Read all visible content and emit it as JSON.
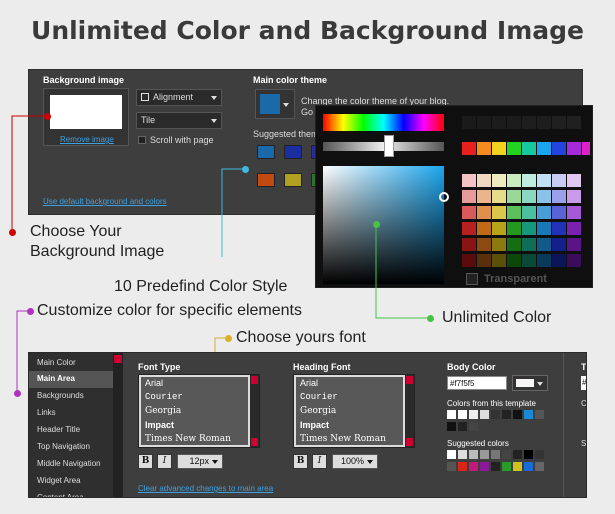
{
  "title": "Unlimited Color and Background Image",
  "background": {
    "label": "Background image",
    "remove_link": "Remove image",
    "alignment": "Alignment",
    "tile": "Tile",
    "scroll_with_page": "Scroll with page",
    "use_default_link": "Use default background and colors"
  },
  "main_theme": {
    "label": "Main color theme",
    "desc": "Change the color theme of your blog.",
    "desc2": "Go",
    "suggested": "Suggested theme",
    "selected_color": "#1a6aaa",
    "swatches": [
      "#1a6aaa",
      "#1a2ea0",
      "#2a2a9a",
      "#c04a10",
      "#b0a020",
      "#2f6f2f"
    ]
  },
  "picker": {
    "transparent": "Transparent",
    "palette_row1": [
      "#e81f1f",
      "#f58a1f",
      "#f5d21f",
      "#22d322",
      "#16c7a0",
      "#1aa6ef",
      "#2344dd",
      "#a52ad9",
      "#e020c8"
    ]
  },
  "callouts": {
    "choose_bg": "Choose Your",
    "choose_bg2": "Background Image",
    "predefined": "10 Predefind Color Style",
    "customize": "Customize color for specific elements",
    "font": "Choose yours font",
    "unlimited": "Unlimited Color"
  },
  "sidebar": {
    "items": [
      "Main Color",
      "Main Area",
      "Backgrounds",
      "Links",
      "Header Title",
      "Top Navigation",
      "Middle Navigation",
      "Widget Area",
      "Content Area"
    ]
  },
  "font_type": {
    "label": "Font Type",
    "fonts": [
      "Arial",
      "Courier",
      "Georgia",
      "Impact",
      "Times New Roman"
    ],
    "bold": "B",
    "italic": "I",
    "size": "12px"
  },
  "heading_font": {
    "label": "Heading Font",
    "fonts": [
      "Arial",
      "Courier",
      "Georgia",
      "Impact",
      "Times New Roman"
    ],
    "bold": "B",
    "italic": "I",
    "size": "100%"
  },
  "body_color": {
    "label": "Body Color",
    "value": "#f7f5f5",
    "from_template": "Colors from this template",
    "suggested": "Suggested colors"
  },
  "clear_link": "Clear advanced changes to main area",
  "partial": {
    "te": "Te",
    "co": "Co",
    "su": "Su",
    "hash": "#"
  }
}
